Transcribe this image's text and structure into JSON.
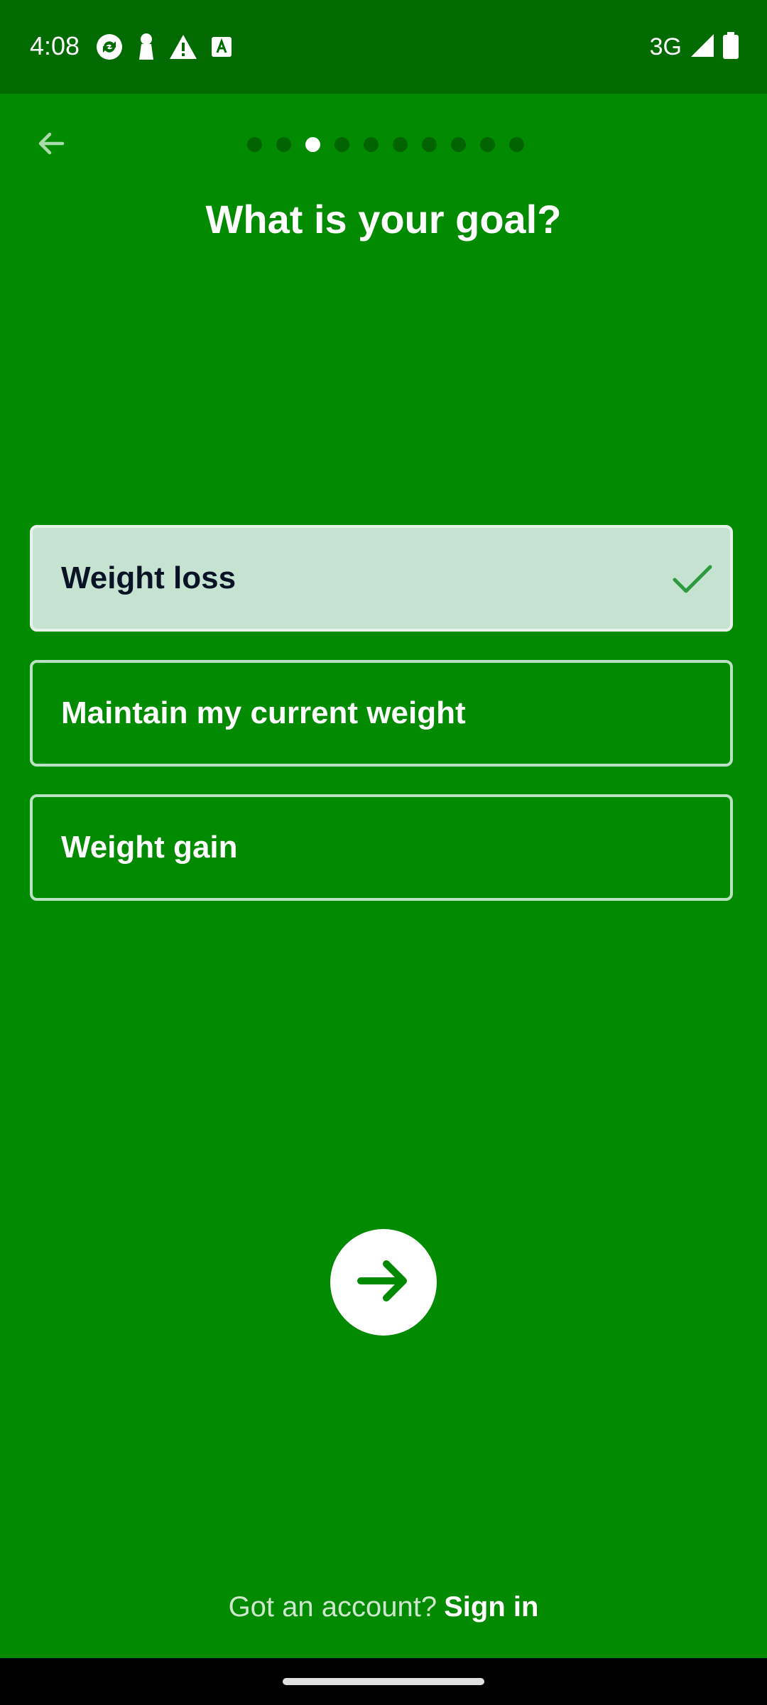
{
  "status_bar": {
    "time": "4:08",
    "network": "3G",
    "icons": [
      "sync-icon",
      "keyhole-icon",
      "warning-icon",
      "font-icon",
      "signal-icon",
      "battery-icon"
    ]
  },
  "header": {
    "back_icon": "arrow-left-icon",
    "progress": {
      "total_steps": 10,
      "current_step": 3
    },
    "title": "What is your goal?"
  },
  "options": [
    {
      "label": "Weight loss",
      "selected": true
    },
    {
      "label": "Maintain my current weight",
      "selected": false
    },
    {
      "label": "Weight gain",
      "selected": false
    }
  ],
  "next_button": {
    "icon": "arrow-right-icon"
  },
  "footer": {
    "prompt": "Got an account?",
    "link": "Sign in"
  },
  "colors": {
    "background": "#028a00",
    "status_bar": "#016a00",
    "selected_option": "#c6e2d1",
    "accent_check": "#2e9a3e"
  }
}
